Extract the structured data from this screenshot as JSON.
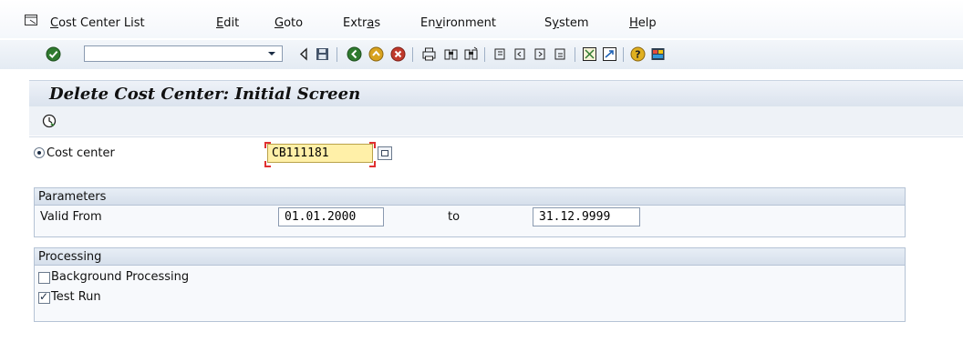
{
  "menu": {
    "items": [
      "Cost Center List",
      "Edit",
      "Goto",
      "Extras",
      "Environment",
      "System",
      "Help"
    ],
    "underline_chars": [
      "C",
      "E",
      "G",
      "a",
      "v",
      "y",
      "H"
    ]
  },
  "toolbar": {
    "command_field_value": "",
    "icons": [
      "enter-icon",
      "back-icon",
      "save-icon",
      "back-green-icon",
      "exit-icon",
      "cancel-icon",
      "print-icon",
      "find-icon",
      "find-next-icon",
      "first-page-icon",
      "previous-page-icon",
      "next-page-icon",
      "last-page-icon",
      "create-session-icon",
      "shortcut-icon",
      "help-icon",
      "customize-layout-icon"
    ]
  },
  "screen": {
    "title": "Delete Cost Center: Initial Screen"
  },
  "cost_center": {
    "label": "Cost center",
    "value": "CB111181"
  },
  "parameters": {
    "title": "Parameters",
    "valid_from_label": "Valid From",
    "valid_from": "01.01.2000",
    "to_label": "to",
    "valid_to": "31.12.9999"
  },
  "processing": {
    "title": "Processing",
    "background_label": "Background Processing",
    "background_checked": false,
    "test_run_label": "Test Run",
    "test_run_checked": true
  }
}
